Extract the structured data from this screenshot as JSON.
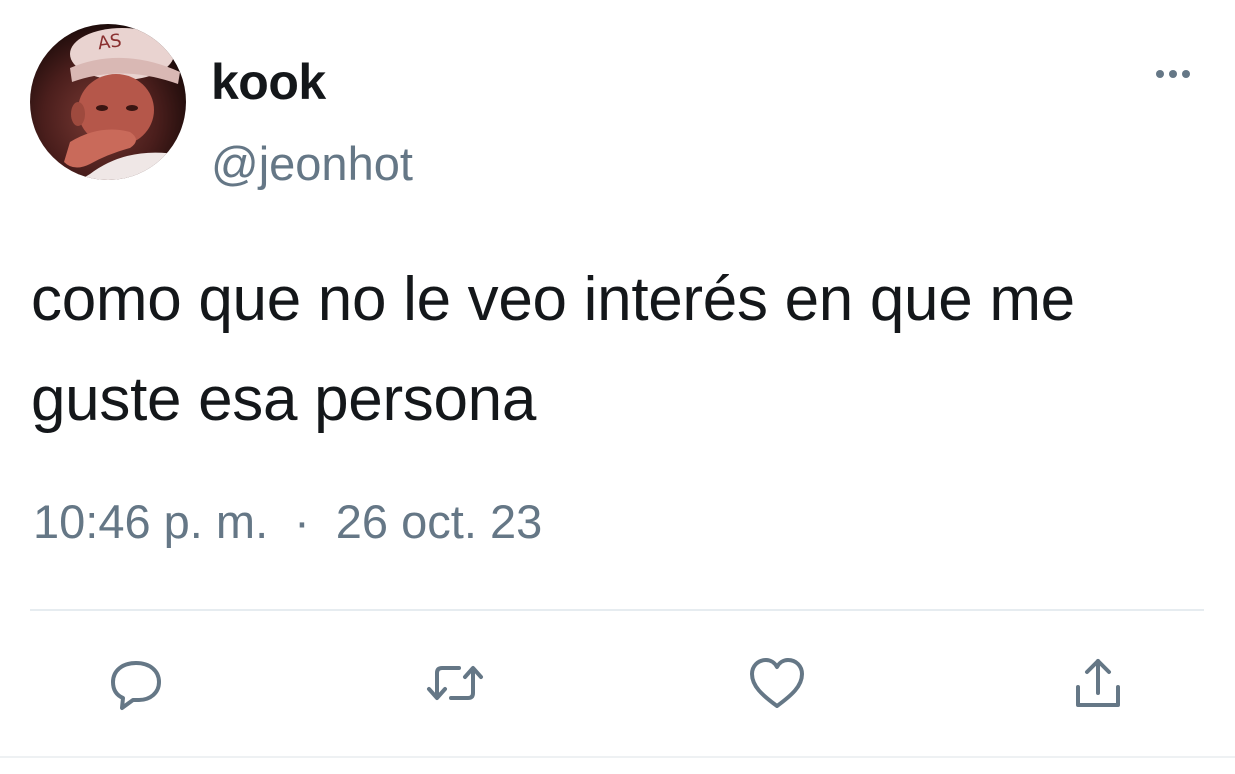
{
  "tweet": {
    "display_name": "kook",
    "handle": "@jeonhot",
    "text": "como que no le veo interés en que me guste esa persona",
    "time": "10:46 p. m.",
    "separator": "·",
    "date": "26 oct. 23"
  },
  "icons": {
    "more": "more-horizontal-icon",
    "reply": "reply-icon",
    "retweet": "retweet-icon",
    "like": "heart-icon",
    "share": "share-icon"
  },
  "colors": {
    "text_primary": "#14171a",
    "text_secondary": "#657786",
    "divider": "#e6ecf0"
  }
}
